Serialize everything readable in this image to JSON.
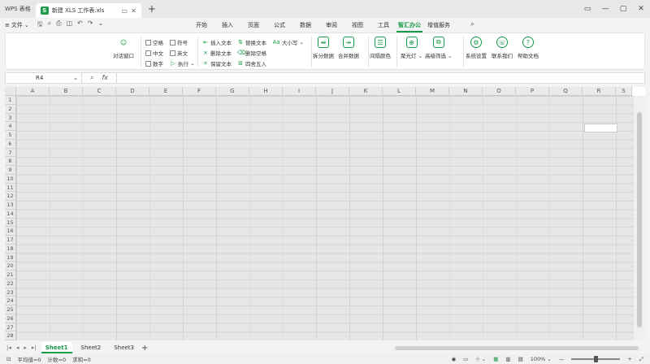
{
  "titlebar": {
    "app_name": "WPS 表格",
    "doc_tab": {
      "icon": "S",
      "title": "新建 XLS 工作表.xls"
    },
    "add_tab": "+",
    "window_controls": [
      "▭",
      "—",
      "▢",
      "✕"
    ]
  },
  "menubar": {
    "file_label": "文件",
    "tabs": [
      "开始",
      "插入",
      "页面",
      "公式",
      "数据",
      "审阅",
      "视图",
      "工具",
      "智汇办公",
      "增值服务"
    ],
    "active_tab": "智汇办公"
  },
  "ribbon": {
    "dialog_window": "对话窗口",
    "checkboxes": [
      "空格",
      "符号",
      "中文",
      "英文",
      "数字"
    ],
    "execute": "执行",
    "text_ops": [
      "插入文本",
      "删除文本",
      "保留文本"
    ],
    "text_ops2": [
      "替换文本",
      "删除空格",
      "四舍五入"
    ],
    "case": "大小写",
    "split_data": "拆分数据",
    "merge_data": "合并数据",
    "interval_color": "间隔颜色",
    "spotlight": "聚光灯",
    "advanced_filter": "高级筛选",
    "system_settings": "系统设置",
    "contact_us": "联系我们",
    "help_doc": "帮助文档"
  },
  "formulabar": {
    "cell_ref": "R4",
    "fx": "fx"
  },
  "grid": {
    "columns": [
      "A",
      "B",
      "C",
      "D",
      "E",
      "F",
      "G",
      "H",
      "I",
      "J",
      "K",
      "L",
      "M",
      "N",
      "O",
      "P",
      "Q",
      "R",
      "S"
    ],
    "rows": [
      "1",
      "2",
      "3",
      "4",
      "5",
      "6",
      "7",
      "8",
      "9",
      "10",
      "11",
      "12",
      "13",
      "14",
      "15",
      "16",
      "17",
      "18",
      "19",
      "20",
      "21",
      "22",
      "23",
      "24",
      "25",
      "26",
      "27",
      "28"
    ]
  },
  "sheets": {
    "tabs": [
      "Sheet1",
      "Sheet2",
      "Sheet3"
    ],
    "active": "Sheet1",
    "add": "+"
  },
  "status": {
    "average": "平均值=0",
    "count": "计数=0",
    "sum": "求和=0",
    "zoom": "100%"
  }
}
